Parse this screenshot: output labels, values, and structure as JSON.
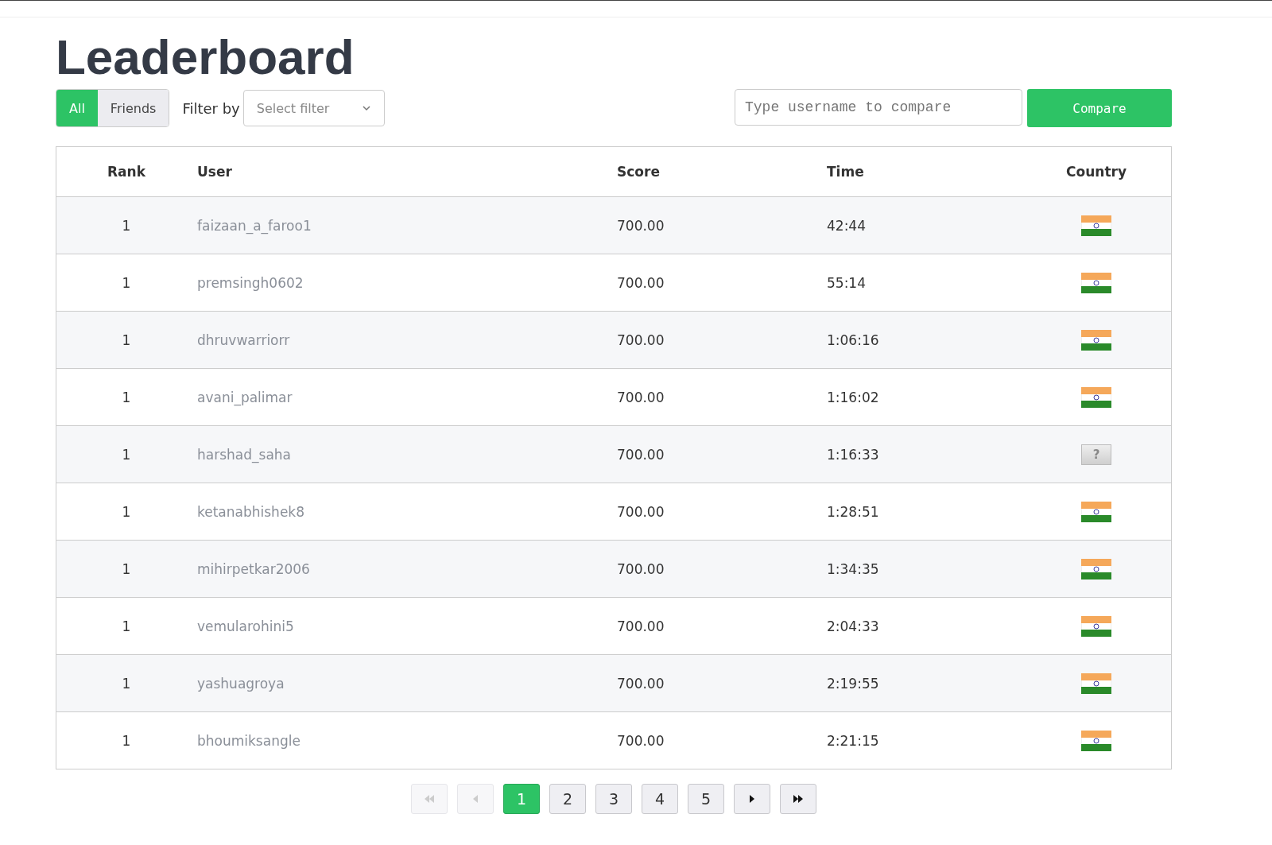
{
  "title": "Leaderboard",
  "scope_tabs": [
    {
      "label": "All",
      "selected": true
    },
    {
      "label": "Friends",
      "selected": false
    }
  ],
  "filter": {
    "label": "Filter by",
    "placeholder": "Select filter"
  },
  "compare": {
    "placeholder": "Type username to compare",
    "button": "Compare"
  },
  "table": {
    "columns": [
      "Rank",
      "User",
      "Score",
      "Time",
      "Country"
    ],
    "rows": [
      {
        "rank": "1",
        "user": "faizaan_a_faroo1",
        "score": "700.00",
        "time": "42:44",
        "country": {
          "kind": "india"
        }
      },
      {
        "rank": "1",
        "user": "premsingh0602",
        "score": "700.00",
        "time": "55:14",
        "country": {
          "kind": "india"
        }
      },
      {
        "rank": "1",
        "user": "dhruvwarriorr",
        "score": "700.00",
        "time": "1:06:16",
        "country": {
          "kind": "india"
        }
      },
      {
        "rank": "1",
        "user": "avani_palimar",
        "score": "700.00",
        "time": "1:16:02",
        "country": {
          "kind": "india"
        }
      },
      {
        "rank": "1",
        "user": "harshad_saha",
        "score": "700.00",
        "time": "1:16:33",
        "country": {
          "kind": "unknown",
          "label": "?"
        }
      },
      {
        "rank": "1",
        "user": "ketanabhishek8",
        "score": "700.00",
        "time": "1:28:51",
        "country": {
          "kind": "india"
        }
      },
      {
        "rank": "1",
        "user": "mihirpetkar2006",
        "score": "700.00",
        "time": "1:34:35",
        "country": {
          "kind": "india"
        }
      },
      {
        "rank": "1",
        "user": "vemularohini5",
        "score": "700.00",
        "time": "2:04:33",
        "country": {
          "kind": "india"
        }
      },
      {
        "rank": "1",
        "user": "yashuagroya",
        "score": "700.00",
        "time": "2:19:55",
        "country": {
          "kind": "india"
        }
      },
      {
        "rank": "1",
        "user": "bhoumiksangle",
        "score": "700.00",
        "time": "2:21:15",
        "country": {
          "kind": "india"
        }
      }
    ]
  },
  "pagination": [
    {
      "kind": "first",
      "disabled": true
    },
    {
      "kind": "prev",
      "disabled": true
    },
    {
      "kind": "page",
      "label": "1",
      "selected": true
    },
    {
      "kind": "page",
      "label": "2",
      "selected": false
    },
    {
      "kind": "page",
      "label": "3",
      "selected": false
    },
    {
      "kind": "page",
      "label": "4",
      "selected": false
    },
    {
      "kind": "page",
      "label": "5",
      "selected": false
    },
    {
      "kind": "next",
      "disabled": false
    },
    {
      "kind": "last",
      "disabled": false
    }
  ]
}
